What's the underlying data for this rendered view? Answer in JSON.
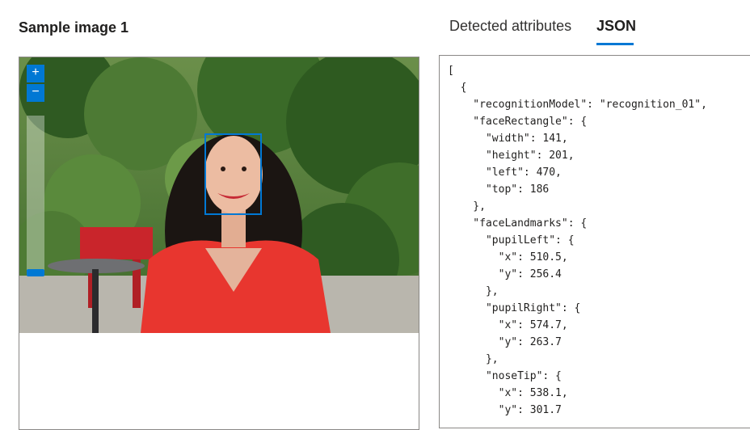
{
  "header": {
    "title": "Sample image 1"
  },
  "tabs": {
    "detected": "Detected attributes",
    "json": "JSON",
    "active": "JSON"
  },
  "viewer": {
    "zoom_in": "+",
    "zoom_out": "−"
  },
  "colors": {
    "accent": "#0078d4"
  },
  "json_view": {
    "lines": [
      "[",
      "  {",
      "    \"recognitionModel\": \"recognition_01\",",
      "    \"faceRectangle\": {",
      "      \"width\": 141,",
      "      \"height\": 201,",
      "      \"left\": 470,",
      "      \"top\": 186",
      "    },",
      "    \"faceLandmarks\": {",
      "      \"pupilLeft\": {",
      "        \"x\": 510.5,",
      "        \"y\": 256.4",
      "      },",
      "      \"pupilRight\": {",
      "        \"x\": 574.7,",
      "        \"y\": 263.7",
      "      },",
      "      \"noseTip\": {",
      "        \"x\": 538.1,",
      "        \"y\": 301.7"
    ]
  }
}
